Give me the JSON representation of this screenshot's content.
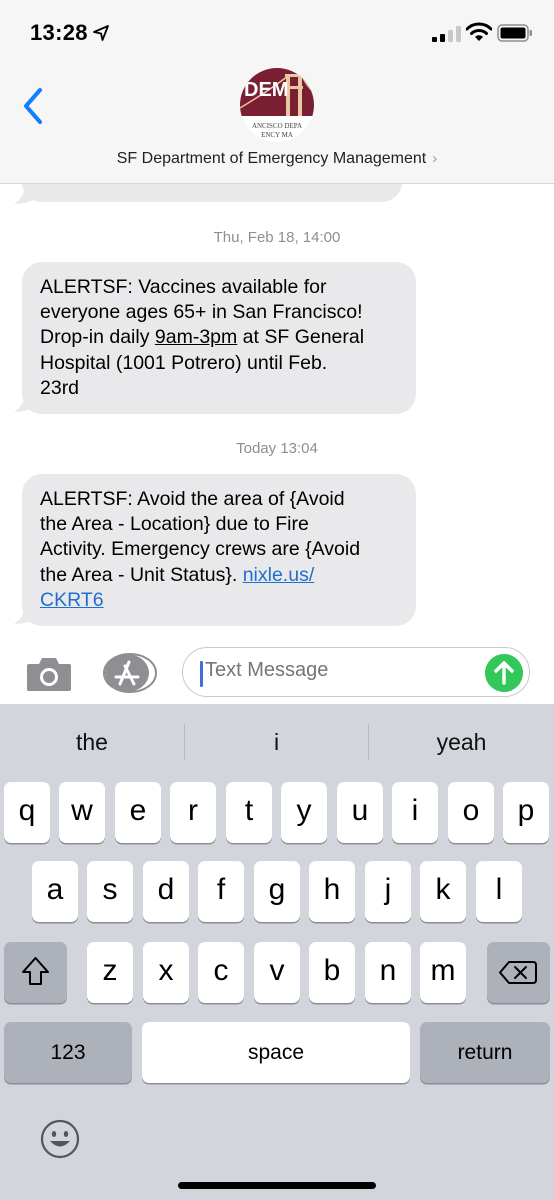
{
  "status_bar": {
    "time": "13:28"
  },
  "header": {
    "back_icon": "chevron-left-icon",
    "avatar_text": "DEM",
    "avatar_subtext_1": "ANCISCO DEPA",
    "avatar_subtext_2": "ENCY MA",
    "contact_name": "SF Department of Emergency Management",
    "chevron": "›"
  },
  "conversation": {
    "timestamp_1": "Thu, Feb 18, 14:00",
    "message_1": {
      "line1": "ALERTSF: Vaccines available for",
      "line2": "everyone ages 65+ in San Francisco!",
      "line3_pre": "Drop-in daily ",
      "line3_underlined": "9am-3pm",
      "line3_post": " at SF General",
      "line4": "Hospital (1001 Potrero) until Feb.",
      "line5": "23rd"
    },
    "timestamp_2": "Today 13:04",
    "message_2": {
      "line1": "ALERTSF: Avoid the area of {Avoid",
      "line2": "the Area - Location} due to Fire",
      "line3": "Activity. Emergency crews are {Avoid",
      "line4_pre": "the Area - Unit Status}. ",
      "line4_link": "nixle.us/",
      "line5_link": "CKRT6"
    }
  },
  "compose": {
    "placeholder": "Text Message",
    "camera_icon": "camera-icon",
    "appstore_icon": "app-store-icon",
    "send_icon": "send-arrow-icon"
  },
  "keyboard": {
    "suggestions": [
      "the",
      "i",
      "yeah"
    ],
    "row1": [
      "q",
      "w",
      "e",
      "r",
      "t",
      "y",
      "u",
      "i",
      "o",
      "p"
    ],
    "row2": [
      "a",
      "s",
      "d",
      "f",
      "g",
      "h",
      "j",
      "k",
      "l"
    ],
    "row3": [
      "z",
      "x",
      "c",
      "v",
      "b",
      "n",
      "m"
    ],
    "numbers_label": "123",
    "space_label": "space",
    "return_label": "return",
    "shift_icon": "shift-icon",
    "delete_icon": "delete-icon",
    "emoji_icon": "emoji-icon"
  },
  "colors": {
    "bubble": "#e9e9eb",
    "link": "#1f6fd0",
    "accent": "#147efb",
    "send": "#34c759",
    "avatar": "#7a1f33"
  }
}
